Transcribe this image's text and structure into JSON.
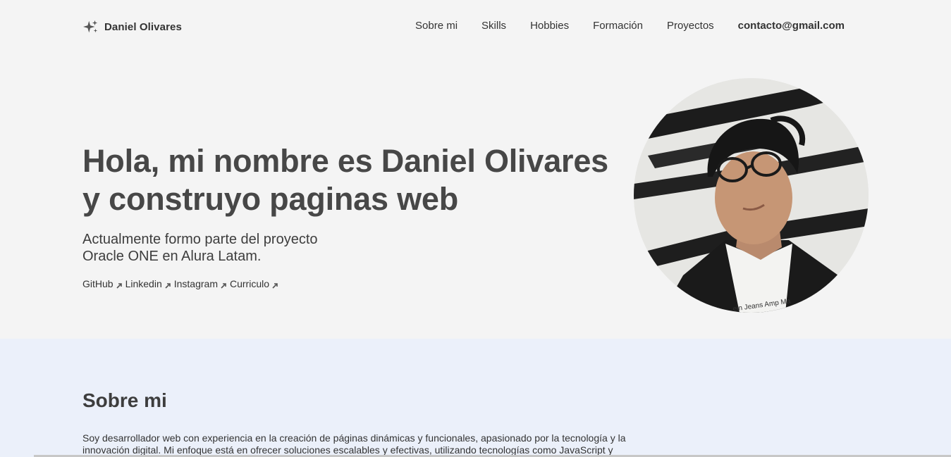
{
  "header": {
    "brand_icon": "sparkle-icon",
    "brand_name": "Daniel Olivares",
    "nav": {
      "sobre_mi": "Sobre mi",
      "skills": "Skills",
      "hobbies": "Hobbies",
      "formacion": "Formación",
      "proyectos": "Proyectos",
      "contacto": "contacto@gmail.com"
    }
  },
  "hero": {
    "title_line1": "Hola, mi nombre es Daniel Olivares",
    "title_line2": "y construyo paginas web",
    "subtitle_line1": "Actualmente formo parte del proyecto",
    "subtitle_line2": "Oracle ONE en Alura Latam.",
    "links": {
      "github": "GitHub",
      "linkedin": "Linkedin",
      "instagram": "Instagram",
      "curriculo": "Curriculo"
    },
    "link_icon": "external-arrow-icon",
    "portrait_shirt_text": "ein Jeans Amp Ma"
  },
  "about": {
    "heading": "Sobre mi",
    "text": "Soy desarrollador web con experiencia en la creación de páginas dinámicas y funcionales, apasionado por la tecnología y la innovación digital. Mi enfoque está en ofrecer soluciones escalables y efectivas, utilizando tecnologías como JavaScript y"
  },
  "colors": {
    "page_bg": "#f4f4f4",
    "about_bg": "#ebf0fa",
    "text": "#464646"
  }
}
